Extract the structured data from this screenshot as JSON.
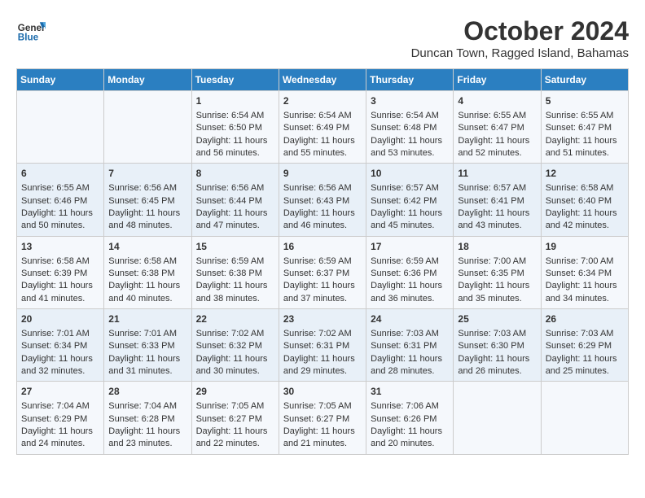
{
  "header": {
    "logo": {
      "general": "General",
      "blue": "Blue"
    },
    "month": "October 2024",
    "location": "Duncan Town, Ragged Island, Bahamas"
  },
  "weekdays": [
    "Sunday",
    "Monday",
    "Tuesday",
    "Wednesday",
    "Thursday",
    "Friday",
    "Saturday"
  ],
  "weeks": [
    [
      {
        "day": "",
        "sunrise": "",
        "sunset": "",
        "daylight": ""
      },
      {
        "day": "",
        "sunrise": "",
        "sunset": "",
        "daylight": ""
      },
      {
        "day": "1",
        "sunrise": "Sunrise: 6:54 AM",
        "sunset": "Sunset: 6:50 PM",
        "daylight": "Daylight: 11 hours and 56 minutes."
      },
      {
        "day": "2",
        "sunrise": "Sunrise: 6:54 AM",
        "sunset": "Sunset: 6:49 PM",
        "daylight": "Daylight: 11 hours and 55 minutes."
      },
      {
        "day": "3",
        "sunrise": "Sunrise: 6:54 AM",
        "sunset": "Sunset: 6:48 PM",
        "daylight": "Daylight: 11 hours and 53 minutes."
      },
      {
        "day": "4",
        "sunrise": "Sunrise: 6:55 AM",
        "sunset": "Sunset: 6:47 PM",
        "daylight": "Daylight: 11 hours and 52 minutes."
      },
      {
        "day": "5",
        "sunrise": "Sunrise: 6:55 AM",
        "sunset": "Sunset: 6:47 PM",
        "daylight": "Daylight: 11 hours and 51 minutes."
      }
    ],
    [
      {
        "day": "6",
        "sunrise": "Sunrise: 6:55 AM",
        "sunset": "Sunset: 6:46 PM",
        "daylight": "Daylight: 11 hours and 50 minutes."
      },
      {
        "day": "7",
        "sunrise": "Sunrise: 6:56 AM",
        "sunset": "Sunset: 6:45 PM",
        "daylight": "Daylight: 11 hours and 48 minutes."
      },
      {
        "day": "8",
        "sunrise": "Sunrise: 6:56 AM",
        "sunset": "Sunset: 6:44 PM",
        "daylight": "Daylight: 11 hours and 47 minutes."
      },
      {
        "day": "9",
        "sunrise": "Sunrise: 6:56 AM",
        "sunset": "Sunset: 6:43 PM",
        "daylight": "Daylight: 11 hours and 46 minutes."
      },
      {
        "day": "10",
        "sunrise": "Sunrise: 6:57 AM",
        "sunset": "Sunset: 6:42 PM",
        "daylight": "Daylight: 11 hours and 45 minutes."
      },
      {
        "day": "11",
        "sunrise": "Sunrise: 6:57 AM",
        "sunset": "Sunset: 6:41 PM",
        "daylight": "Daylight: 11 hours and 43 minutes."
      },
      {
        "day": "12",
        "sunrise": "Sunrise: 6:58 AM",
        "sunset": "Sunset: 6:40 PM",
        "daylight": "Daylight: 11 hours and 42 minutes."
      }
    ],
    [
      {
        "day": "13",
        "sunrise": "Sunrise: 6:58 AM",
        "sunset": "Sunset: 6:39 PM",
        "daylight": "Daylight: 11 hours and 41 minutes."
      },
      {
        "day": "14",
        "sunrise": "Sunrise: 6:58 AM",
        "sunset": "Sunset: 6:38 PM",
        "daylight": "Daylight: 11 hours and 40 minutes."
      },
      {
        "day": "15",
        "sunrise": "Sunrise: 6:59 AM",
        "sunset": "Sunset: 6:38 PM",
        "daylight": "Daylight: 11 hours and 38 minutes."
      },
      {
        "day": "16",
        "sunrise": "Sunrise: 6:59 AM",
        "sunset": "Sunset: 6:37 PM",
        "daylight": "Daylight: 11 hours and 37 minutes."
      },
      {
        "day": "17",
        "sunrise": "Sunrise: 6:59 AM",
        "sunset": "Sunset: 6:36 PM",
        "daylight": "Daylight: 11 hours and 36 minutes."
      },
      {
        "day": "18",
        "sunrise": "Sunrise: 7:00 AM",
        "sunset": "Sunset: 6:35 PM",
        "daylight": "Daylight: 11 hours and 35 minutes."
      },
      {
        "day": "19",
        "sunrise": "Sunrise: 7:00 AM",
        "sunset": "Sunset: 6:34 PM",
        "daylight": "Daylight: 11 hours and 34 minutes."
      }
    ],
    [
      {
        "day": "20",
        "sunrise": "Sunrise: 7:01 AM",
        "sunset": "Sunset: 6:34 PM",
        "daylight": "Daylight: 11 hours and 32 minutes."
      },
      {
        "day": "21",
        "sunrise": "Sunrise: 7:01 AM",
        "sunset": "Sunset: 6:33 PM",
        "daylight": "Daylight: 11 hours and 31 minutes."
      },
      {
        "day": "22",
        "sunrise": "Sunrise: 7:02 AM",
        "sunset": "Sunset: 6:32 PM",
        "daylight": "Daylight: 11 hours and 30 minutes."
      },
      {
        "day": "23",
        "sunrise": "Sunrise: 7:02 AM",
        "sunset": "Sunset: 6:31 PM",
        "daylight": "Daylight: 11 hours and 29 minutes."
      },
      {
        "day": "24",
        "sunrise": "Sunrise: 7:03 AM",
        "sunset": "Sunset: 6:31 PM",
        "daylight": "Daylight: 11 hours and 28 minutes."
      },
      {
        "day": "25",
        "sunrise": "Sunrise: 7:03 AM",
        "sunset": "Sunset: 6:30 PM",
        "daylight": "Daylight: 11 hours and 26 minutes."
      },
      {
        "day": "26",
        "sunrise": "Sunrise: 7:03 AM",
        "sunset": "Sunset: 6:29 PM",
        "daylight": "Daylight: 11 hours and 25 minutes."
      }
    ],
    [
      {
        "day": "27",
        "sunrise": "Sunrise: 7:04 AM",
        "sunset": "Sunset: 6:29 PM",
        "daylight": "Daylight: 11 hours and 24 minutes."
      },
      {
        "day": "28",
        "sunrise": "Sunrise: 7:04 AM",
        "sunset": "Sunset: 6:28 PM",
        "daylight": "Daylight: 11 hours and 23 minutes."
      },
      {
        "day": "29",
        "sunrise": "Sunrise: 7:05 AM",
        "sunset": "Sunset: 6:27 PM",
        "daylight": "Daylight: 11 hours and 22 minutes."
      },
      {
        "day": "30",
        "sunrise": "Sunrise: 7:05 AM",
        "sunset": "Sunset: 6:27 PM",
        "daylight": "Daylight: 11 hours and 21 minutes."
      },
      {
        "day": "31",
        "sunrise": "Sunrise: 7:06 AM",
        "sunset": "Sunset: 6:26 PM",
        "daylight": "Daylight: 11 hours and 20 minutes."
      },
      {
        "day": "",
        "sunrise": "",
        "sunset": "",
        "daylight": ""
      },
      {
        "day": "",
        "sunrise": "",
        "sunset": "",
        "daylight": ""
      }
    ]
  ]
}
